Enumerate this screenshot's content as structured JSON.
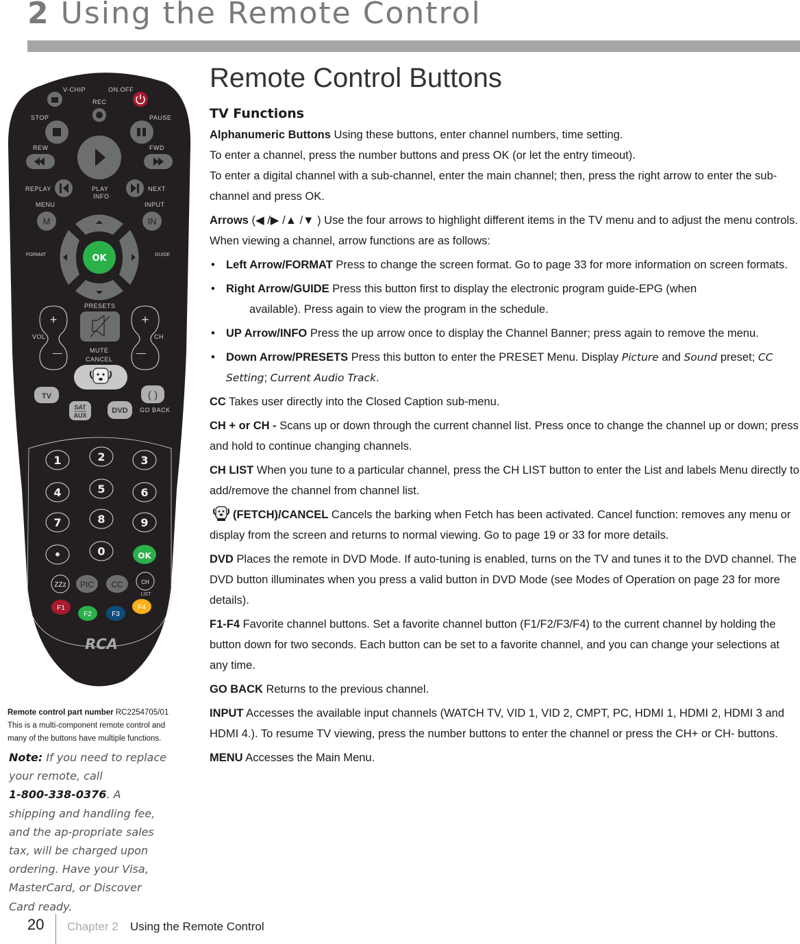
{
  "chapter": {
    "number": "2",
    "title": "Using the Remote Control"
  },
  "remote": {
    "labels": {
      "vchip": "V-CHIP",
      "onoff": "ON.OFF",
      "rec": "REC",
      "stop": "STOP",
      "pause": "PAUSE",
      "rew": "REW",
      "fwd": "FWD",
      "replay": "REPLAY",
      "next": "NEXT",
      "play": "PLAY",
      "info": "INFO",
      "menu": "MENU",
      "input": "INPUT",
      "format": "FORMAT",
      "guide": "GUIDE",
      "presets": "PRESETS",
      "vol": "VOL",
      "ch": "CH",
      "mute": "MUTE",
      "cancel": "CANCEL",
      "goback": "GO BACK",
      "list": "LIST"
    },
    "buttons": {
      "menu": "M",
      "input": "IN",
      "ok": "OK",
      "tv": "TV",
      "sat": "SAT",
      "aux": "AUX",
      "dvd": "DVD",
      "digits": [
        "1",
        "2",
        "3",
        "4",
        "5",
        "6",
        "7",
        "8",
        "9",
        "•",
        "0",
        "OK"
      ],
      "zzz": "ZZz",
      "pic": "PIC",
      "cc": "CC",
      "ch": "CH",
      "f1": "F1",
      "f2": "F2",
      "f3": "F3",
      "f4": "F4",
      "brand": "RCA",
      "plus": "+",
      "minus": "—"
    },
    "colors": {
      "body": "#231f20",
      "key": "#6d6e70",
      "power": "#a6192e",
      "ok": "#2bb04a",
      "f1": "#a6192e",
      "f2": "#2bb04a",
      "f3": "#0d4c7a",
      "f4": "#fbb017"
    }
  },
  "part": {
    "label": "Remote control part number",
    "number": "RC2254705/01",
    "desc": "This is a multi-component remote control and many of the buttons have multiple functions."
  },
  "note": {
    "label": "Note:",
    "text1": "If you need to replace your remote, call",
    "phone": "1-800-338-0376",
    "text2": ". A shipping and handling fee, and the ap-propriate sales tax, will be charged upon ordering. Have your Visa, MasterCard, or Discover Card ready."
  },
  "section": {
    "title": "Remote Control Buttons",
    "subtitle": "TV Functions",
    "alphanumeric": {
      "term": "Alphanumeric Buttons",
      "text": " Using these buttons, enter channel numbers, time setting.",
      "line2": "To enter a channel, press the number buttons and press OK (or let the entry timeout).",
      "line3": "To enter a digital channel with a sub-channel, enter the main channel; then, press the right arrow to enter the sub-channel and press OK."
    },
    "arrows": {
      "term": "Arrows",
      "symbols": " (◀ /▶ /▲ /▼ ) ",
      "text": " Use the four arrows to highlight different items in the TV menu and to adjust the menu controls. When viewing a channel, arrow functions are as follows:",
      "items": [
        {
          "term": "Left Arrow/FORMAT",
          "text": "  Press to change the screen format. Go to page 33 for more information on screen formats."
        },
        {
          "term": "Right Arrow/GUIDE",
          "text": "  Press this button first to display the electronic program guide-EPG (when",
          "cont": "available). Press again to view the program in the schedule."
        },
        {
          "term": "UP Arrow/INFO",
          "text": "  Press the up arrow once to display the Channel Banner; press again to remove the menu."
        },
        {
          "term": "Down Arrow/PRESETS",
          "text": "  Press this button to enter the PRESET Menu. Display ",
          "it1": "Picture",
          "and": " and ",
          "it2": "Sound",
          "pre": " preset; ",
          "it3": "CC Setting",
          "semi": "; ",
          "it4": "Current Audio Track",
          "end": "."
        }
      ]
    },
    "entries": [
      {
        "term": "CC",
        "text": " Takes user directly into the Closed Caption sub-menu."
      },
      {
        "term": "CH + or CH -",
        "text": " Scans up or down through the current channel list. Press once to change the channel up or down; press and hold to continue changing channels."
      },
      {
        "term": "CH LIST",
        "text": " When you tune to a particular channel, press the CH LIST button to enter the List and labels Menu directly to add/remove the channel from channel list."
      },
      {
        "term": "(FETCH)/CANCEL",
        "text": " Cancels the barking when Fetch has been activated. Cancel function: removes any menu or display from the screen and returns to normal viewing. Go to page 19 or 33 for more details.",
        "icon": "dog-icon"
      },
      {
        "term": "DVD",
        "text": " Places the remote in DVD Mode. If auto-tuning is enabled, turns on the TV and tunes it to the DVD channel. The DVD button illuminates when you press a valid button in DVD Mode (see Modes of Operation on page 23 for more details)."
      },
      {
        "term": "F1-F4",
        "text": " Favorite channel buttons. Set a favorite channel button (F1/F2/F3/F4) to the current channel by holding the button down for two seconds. Each button can be set to a favorite channel, and you can change your selections at any time."
      },
      {
        "term": "GO BACK",
        "text": " Returns to the previous channel."
      },
      {
        "term": "INPUT",
        "text": " Accesses the available input channels (WATCH TV, VID 1, VID 2, CMPT, PC, HDMI 1, HDMI 2, HDMI 3 and HDMI 4.). To resume TV viewing, press the number buttons to enter the channel or press the CH+ or CH- buttons."
      },
      {
        "term": "MENU",
        "text": " Accesses the Main Menu."
      }
    ]
  },
  "footer": {
    "page": "20",
    "chapter": "Chapter 2",
    "title": "Using the Remote Control"
  }
}
